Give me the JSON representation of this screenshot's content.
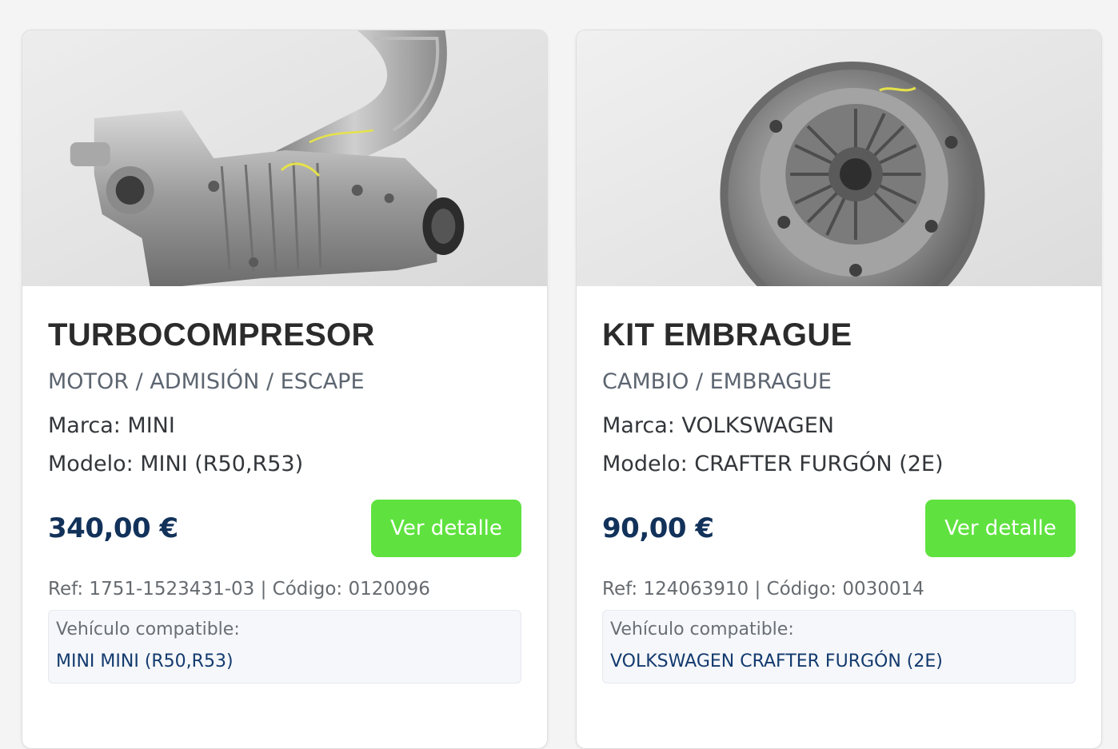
{
  "cards": [
    {
      "image_alt": "turbocompresor part photo",
      "title": "TURBOCOMPRESOR",
      "category": "MOTOR / ADMISIÓN / ESCAPE",
      "marca": "Marca: MINI",
      "modelo": "Modelo: MINI (R50,R53)",
      "price": "340,00 €",
      "button": "Ver detalle",
      "ref": "Ref: 1751-1523431-03 | Código: 0120096",
      "compat_label": "Vehículo compatible:",
      "compat_value": "MINI MINI (R50,R53)"
    },
    {
      "image_alt": "kit embrague part photo",
      "title": "KIT EMBRAGUE",
      "category": "CAMBIO / EMBRAGUE",
      "marca": "Marca: VOLKSWAGEN",
      "modelo": "Modelo: CRAFTER FURGÓN (2E)",
      "price": "90,00 €",
      "button": "Ver detalle",
      "ref": "Ref: 124063910 | Código: 0030014",
      "compat_label": "Vehículo compatible:",
      "compat_value": "VOLKSWAGEN CRAFTER FURGÓN (2E)"
    }
  ],
  "colors": {
    "button": "#5fe23f",
    "price": "#12325a",
    "compat_value": "#133a6e"
  }
}
